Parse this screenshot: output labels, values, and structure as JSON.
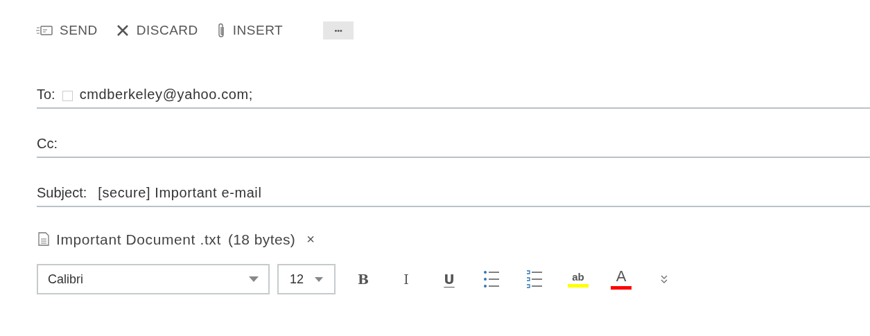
{
  "toolbar": [
    {
      "kind": "send",
      "label": "SEND"
    },
    {
      "kind": "discard",
      "label": "DISCARD"
    },
    {
      "kind": "insert",
      "label": "INSERT"
    },
    {
      "kind": "more",
      "label": "•••"
    }
  ],
  "fields": [
    {
      "label": "To:",
      "checkbox": {
        "checked": false
      },
      "value": "cmdberkeley@yahoo.com;"
    },
    {
      "label": "Cc:"
    },
    {
      "label": "Subject:",
      "value": "[secure] Important e-mail"
    }
  ],
  "attachment": {
    "name": "Important Document .txt",
    "size": "(18 bytes)",
    "remove": "×"
  },
  "format": {
    "font": "Calibri",
    "size": "12",
    "buttons": [
      {
        "kind": "bold",
        "text": "B"
      },
      {
        "kind": "italic",
        "text": "I"
      },
      {
        "kind": "underline",
        "text": "U"
      },
      {
        "kind": "bullets"
      },
      {
        "kind": "numbers"
      },
      {
        "kind": "highlight",
        "text": "ab",
        "color": "#ffff00"
      },
      {
        "kind": "fontcolor",
        "text": "A",
        "color": "#ff0000"
      },
      {
        "kind": "expand"
      }
    ]
  }
}
